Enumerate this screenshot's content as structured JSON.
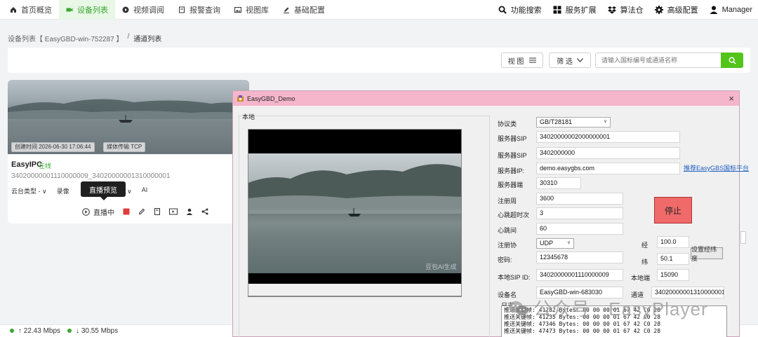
{
  "nav": {
    "items": [
      {
        "label": "首页概览",
        "icon": "home-icon"
      },
      {
        "label": "设备列表",
        "icon": "camera-icon",
        "active": true
      },
      {
        "label": "视频调阅",
        "icon": "play-icon"
      },
      {
        "label": "报警查询",
        "icon": "bell-icon"
      },
      {
        "label": "视图库",
        "icon": "image-icon"
      },
      {
        "label": "基础配置",
        "icon": "edit-icon"
      }
    ],
    "right": [
      {
        "label": "功能搜索",
        "icon": "search-icon"
      },
      {
        "label": "服务扩展",
        "icon": "grid-icon"
      },
      {
        "label": "算法仓",
        "icon": "dropbox-icon"
      },
      {
        "label": "高级配置",
        "icon": "gear-icon"
      },
      {
        "label": "Manager",
        "icon": "user-icon"
      }
    ]
  },
  "breadcrumb": {
    "parent": "设备列表【 EasyGBD-win-752287 】",
    "sep": "/",
    "current": "通道列表"
  },
  "filter": {
    "view_label": "视 图",
    "filter_label": "筛 选",
    "search_placeholder": "请输入国标编号或通道名称"
  },
  "card": {
    "created": "创建时间 2026-06-30 17:06:44",
    "transport": "媒体传输 TCP",
    "name": "EasyIPC",
    "status": "在线",
    "id": "34020000001110000009_34020000001310000001",
    "opts": [
      "云台类型 - ∨",
      "录像",
      "按需直播 ∨",
      "AI"
    ],
    "tooltip": "直播预览",
    "live_label": "直播中"
  },
  "statusbar": {
    "up": "↑ 22.43 Mbps",
    "down": "↓ 30.55 Mbps"
  },
  "dialog": {
    "title": "EasyGBD_Demo",
    "close": "×",
    "local_label": "本地",
    "video_watermark": "豆包AI生成",
    "fields": {
      "protocol_label": "协议类",
      "protocol_value": "GB/T28181",
      "server_sip_label": "服务器SIP",
      "server_sip_value": "34020000002000000001",
      "server_sip2_label": "服务器SIP",
      "server_sip2_value": "3402000000",
      "server_ip_label": "服务器IP:",
      "server_ip_value": "demo.easygbs.com",
      "server_port_label": "服务器端",
      "server_port_value": "30310",
      "register_label": "注册周",
      "register_value": "3600",
      "heartbeat_timeout_label": "心跳超时次",
      "heartbeat_timeout_value": "3",
      "heartbeat_label": "心跳间",
      "heartbeat_value": "60",
      "reg_proto_label": "注册协",
      "reg_proto_value": "UDP",
      "password_label": "密码:",
      "password_value": "12345678",
      "local_sip_label": "本地SIP ID:",
      "local_sip_value": "34020000001110000009",
      "device_name_label": "设备名",
      "device_name_value": "EasyGBD-win-683030",
      "lng_label": "经",
      "lng_value": "100.0",
      "lat_label": "纬",
      "lat_value": "50.1",
      "local_port_label": "本地端",
      "local_port_value": "15090",
      "channel_label": "通道",
      "channel_value": "34020000001310000001"
    },
    "link": "推荐EasyGBS国标平台",
    "stop_label": "停止",
    "set_lnglat_label": "设置经纬度",
    "log_label": "日志",
    "log_lines": [
      "推送关键帧: 41282  Bytes: 00 00 00 01 67 42 C0 28",
      "推送关键帧: 41235  Bytes: 00 00 00 01 67 42 C0 28",
      "推送关键帧: 47346  Bytes: 00 00 00 01 67 42 C0 28",
      "推送关键帧: 47473  Bytes: 00 00 00 01 67 42 C0 28"
    ]
  },
  "watermark": {
    "text": "公众号 · EasyPlayer"
  }
}
